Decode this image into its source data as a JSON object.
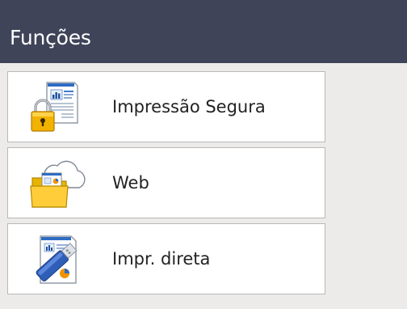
{
  "header": {
    "title": "Funções"
  },
  "menu": {
    "items": [
      {
        "label": "Impressão Segura",
        "icon": "secure-print-icon"
      },
      {
        "label": "Web",
        "icon": "web-folder-cloud-icon"
      },
      {
        "label": "Impr. direta",
        "icon": "usb-direct-print-icon"
      }
    ]
  },
  "colors": {
    "header_bg": "#3f4459",
    "panel_bg": "#ecebea",
    "button_bg": "#ffffff",
    "button_border": "#b9b9b9",
    "text": "#222222"
  }
}
